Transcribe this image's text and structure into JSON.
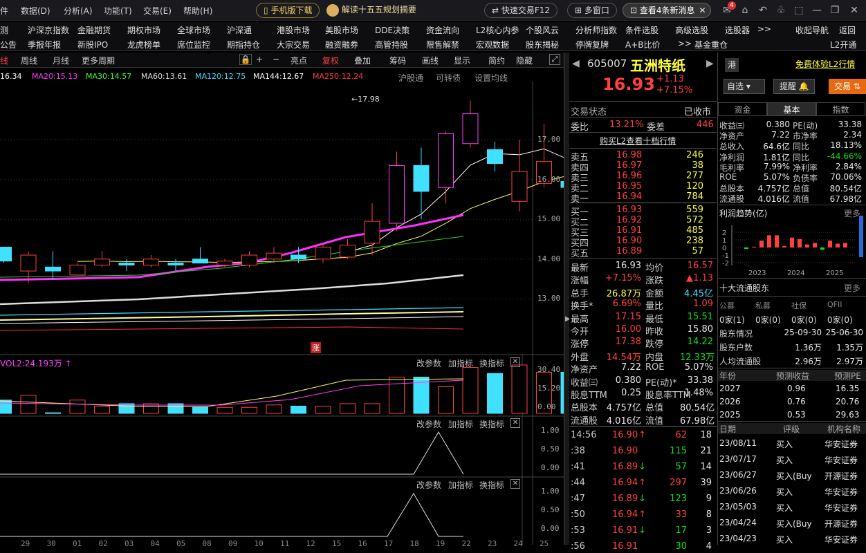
{
  "titlebar": {
    "menus": [
      "数据(D)",
      "分析(A)",
      "功能(T)",
      "交易(E)",
      "帮助(H)"
    ],
    "mobile_btn": "手机版下载",
    "promo": "解读十五五规划摘要",
    "quick_trade": "快速交易F12",
    "multi_window": "多窗口",
    "news": "查看4条新消息",
    "badge": "4"
  },
  "nav1": [
    "测",
    "沪深京指数",
    "金融期货",
    "期权市场",
    "全球市场",
    "沪深通",
    "港股市场",
    "美股市场",
    "DDE决策",
    "资金流向",
    "L2核心内参",
    "个股风云",
    "分析师指数",
    "条件选股",
    "高级选股",
    "选股器",
    ">>",
    "收起导航",
    "返回"
  ],
  "nav2": [
    "公告",
    "季报年报",
    "新股IPO",
    "龙虎榜单",
    "席位监控",
    "期指持仓",
    "大宗交易",
    "融资融券",
    "高管持股",
    "限售解禁",
    "宏观数据",
    "股东揭秘",
    "停牌复牌",
    "A+B比价",
    ">>",
    "基金重仓",
    "L2开通"
  ],
  "chartbar": {
    "tabs": [
      "线",
      "周线",
      "月线",
      "更多周期"
    ],
    "tools": [
      "亮点",
      "复权",
      "叠加",
      "筹码",
      "画线",
      "显示",
      "简约",
      "隐藏"
    ]
  },
  "ma_legend": [
    {
      "t": "16.34",
      "c": "#ffffff"
    },
    {
      "t": "MA20:15.13",
      "c": "#ff40ff"
    },
    {
      "t": "MA30:14.57",
      "c": "#40ff40"
    },
    {
      "t": "MA60:13.61",
      "c": "#e0e0e0"
    },
    {
      "t": "MA120:12.75",
      "c": "#40e0ff"
    },
    {
      "t": "MA144:12.67",
      "c": "#ffffff"
    },
    {
      "t": "MA250:12.24",
      "c": "#ff4040"
    }
  ],
  "ma_right": [
    "沪股通",
    "可转债",
    "设置均线"
  ],
  "chart_data": [
    {
      "type": "candlestick",
      "x": [
        "09",
        "10",
        "11",
        "12",
        "13",
        "14",
        "15",
        "16",
        "17",
        "18",
        "19",
        "20",
        "21",
        "22",
        "23",
        "24",
        "25",
        "26",
        "27",
        "28",
        "29",
        "30",
        "01",
        "02",
        "03",
        "04",
        "05"
      ],
      "candles": [
        {
          "o": 14.0,
          "h": 14.2,
          "l": 13.8,
          "c": 14.1
        },
        {
          "o": 14.3,
          "h": 14.3,
          "l": 13.9,
          "c": 13.95
        },
        {
          "o": 13.7,
          "h": 14.2,
          "l": 13.4,
          "c": 14.1
        },
        {
          "o": 13.8,
          "h": 14.2,
          "l": 13.5,
          "c": 13.7
        },
        {
          "o": 13.6,
          "h": 13.9,
          "l": 13.6,
          "c": 13.85
        },
        {
          "o": 13.85,
          "h": 14.2,
          "l": 13.8,
          "c": 14.0
        },
        {
          "o": 13.9,
          "h": 14.0,
          "l": 13.7,
          "c": 13.85
        },
        {
          "o": 13.85,
          "h": 14.1,
          "l": 13.8,
          "c": 14.0
        },
        {
          "o": 13.9,
          "h": 14.0,
          "l": 13.7,
          "c": 13.85
        },
        {
          "o": 14.0,
          "h": 14.3,
          "l": 13.9,
          "c": 13.9
        },
        {
          "o": 13.85,
          "h": 14.0,
          "l": 13.8,
          "c": 13.95
        },
        {
          "o": 13.85,
          "h": 14.2,
          "l": 13.8,
          "c": 14.1
        },
        {
          "o": 14.0,
          "h": 14.3,
          "l": 13.9,
          "c": 14.15
        },
        {
          "o": 14.1,
          "h": 14.3,
          "l": 13.9,
          "c": 14.0
        },
        {
          "o": 14.0,
          "h": 14.4,
          "l": 13.9,
          "c": 14.3
        },
        {
          "o": 14.05,
          "h": 14.5,
          "l": 14.0,
          "c": 14.35
        },
        {
          "o": 14.4,
          "h": 15.4,
          "l": 14.1,
          "c": 14.95
        },
        {
          "o": 14.9,
          "h": 16.7,
          "l": 14.7,
          "c": 16.35
        },
        {
          "o": 16.35,
          "h": 16.8,
          "l": 15.0,
          "c": 15.7
        },
        {
          "o": 15.8,
          "h": 17.2,
          "l": 15.4,
          "c": 17.15
        },
        {
          "o": 16.9,
          "h": 17.98,
          "l": 16.8,
          "c": 17.65
        },
        {
          "o": 16.75,
          "h": 16.95,
          "l": 16.2,
          "c": 16.4
        },
        {
          "o": 15.45,
          "h": 17.0,
          "l": 15.2,
          "c": 16.2
        },
        {
          "o": 15.9,
          "h": 17.4,
          "l": 15.8,
          "c": 16.45
        },
        {
          "o": 15.95,
          "h": 16.1,
          "l": 15.7,
          "c": 15.8
        },
        {
          "o": 15.8,
          "h": 16.1,
          "l": 15.6,
          "c": 15.95
        },
        {
          "o": 16.0,
          "h": 17.15,
          "l": 15.51,
          "c": 16.93
        }
      ],
      "high_label": "17.98",
      "ylabels": [
        "17.00",
        "16.00",
        "15.00",
        "14.00",
        "13.00"
      ],
      "limit_up_tag": "涨"
    },
    {
      "type": "bar",
      "title": "VOL2:24.193万",
      "values": [
        0.5,
        11,
        15,
        0.5,
        11,
        6,
        8,
        8,
        8,
        5,
        5,
        5,
        7,
        6,
        6,
        8,
        8,
        30,
        30,
        22,
        38,
        33,
        40,
        34,
        34,
        37,
        37
      ],
      "ylabels": [
        "30.40",
        "15.20",
        "0.00"
      ]
    }
  ],
  "subpanels": {
    "links": [
      "改参数",
      "加指标",
      "换指标"
    ],
    "axis1": [
      "1.00",
      "0.50",
      "0.00"
    ],
    "axis2": [
      "1.00",
      "0.50",
      "0.00"
    ]
  },
  "bottom_dates": [
    "29",
    "30",
    "01",
    "02",
    "03",
    "04",
    "05",
    "08",
    "09",
    "10",
    "11",
    "12",
    "15",
    "16",
    "17",
    "18",
    "19",
    "22",
    "23",
    "24",
    "25"
  ],
  "quote": {
    "code": "605007",
    "name": "五洲特纸",
    "price": "16.93",
    "change": "+1.13",
    "pct": "+7.15%",
    "status_label": "交易状态",
    "status": "已收市",
    "weibi_label": "委比",
    "weibi": "13.21%",
    "weicha_label": "委差",
    "weicha": "446",
    "l2_link": "购买L2查看十档行情",
    "asks": [
      [
        "卖五",
        "16.98",
        "246"
      ],
      [
        "卖四",
        "16.97",
        "38"
      ],
      [
        "卖三",
        "16.96",
        "277"
      ],
      [
        "卖二",
        "16.95",
        "120"
      ],
      [
        "卖一",
        "16.94",
        "784"
      ]
    ],
    "bids": [
      [
        "买一",
        "16.93",
        "559"
      ],
      [
        "买二",
        "16.92",
        "572"
      ],
      [
        "买三",
        "16.91",
        "485"
      ],
      [
        "买四",
        "16.90",
        "238"
      ],
      [
        "买五",
        "16.89",
        "57"
      ]
    ],
    "stats": [
      [
        "最新",
        "16.93",
        "均价",
        "16.57"
      ],
      [
        "涨幅",
        "+7.15%",
        "涨跌",
        "▲1.13"
      ],
      [
        "总手",
        "26.87万",
        "金额",
        "4.45亿"
      ],
      [
        "换手*",
        "6.69%",
        "量比",
        "1.09"
      ],
      [
        "最高",
        "17.15",
        "最低",
        "15.51"
      ],
      [
        "今开",
        "16.00",
        "昨收",
        "15.80"
      ],
      [
        "涨停",
        "17.38",
        "跌停",
        "14.22"
      ],
      [
        "外盘",
        "14.54万",
        "内盘",
        "12.33万"
      ],
      [
        "净资产",
        "7.22",
        "ROE",
        "5.07%"
      ],
      [
        "收益㈢",
        "0.380",
        "PE(动)*",
        "33.38"
      ],
      [
        "股息TTM",
        "0.25",
        "股息率TTM",
        "1.48%"
      ],
      [
        "总股本",
        "4.757亿",
        "总值",
        "80.54亿"
      ],
      [
        "流通股",
        "4.016亿",
        "流值",
        "67.98亿"
      ]
    ],
    "ticks": [
      [
        "14:56",
        "16.90",
        "↑",
        "62",
        "18"
      ],
      [
        ":38",
        "16.90",
        "",
        "115",
        "21"
      ],
      [
        ":41",
        "16.89",
        "↓",
        "57",
        "14"
      ],
      [
        ":44",
        "16.94",
        "↑",
        "297",
        "39"
      ],
      [
        ":47",
        "16.89",
        "↓",
        "123",
        "9"
      ],
      [
        ":50",
        "16.94",
        "↑",
        "33",
        "8"
      ],
      [
        ":53",
        "16.91",
        "↓",
        "17",
        "3"
      ],
      [
        ":56",
        "16.91",
        "",
        "30",
        "4"
      ]
    ]
  },
  "f10": {
    "hk": "港",
    "free_l2": "免费体验L2行情",
    "zixuan": "自选",
    "tixing": "提醒",
    "trade": "交易",
    "tabs": [
      "资金",
      "基本",
      "指数"
    ],
    "fund": [
      [
        "收益㈢",
        "0.380",
        "PE(动)",
        "33.38"
      ],
      [
        "净资产",
        "7.22",
        "市净率",
        "2.34"
      ],
      [
        "总收入",
        "64.6亿",
        "同比",
        "18.13%"
      ],
      [
        "净利润",
        "1.81亿",
        "同比",
        "-44.66%"
      ],
      [
        "毛利率",
        "7.99%",
        "净利率",
        "2.84%"
      ],
      [
        "ROE",
        "5.07%",
        "负债率",
        "70.06%"
      ],
      [
        "总股本",
        "4.757亿",
        "总值",
        "80.54亿"
      ],
      [
        "流通股",
        "4.016亿",
        "流值",
        "67.98亿"
      ]
    ],
    "profit_title": "利润趋势(亿)",
    "more": "更多",
    "profit_years": [
      "2023",
      "2024",
      "2025"
    ],
    "profit_axis": [
      "2",
      "1",
      "0",
      "-1",
      "-2"
    ],
    "profit_values": [
      -0.2,
      0.1,
      0.9,
      1.6,
      1.6,
      0.2,
      1.3,
      1.1,
      0.4,
      0.6,
      -0.3,
      0.9,
      0.5,
      0.6
    ],
    "holders_title": "十大流通股东",
    "holder_cols": [
      "公募",
      "私募",
      "社保",
      "QFII"
    ],
    "holder_vals": [
      "0家(1)",
      "0家(0)",
      "0家(0)",
      "0家(0)"
    ],
    "holder_rows": [
      [
        "股东情况",
        "25-09-30",
        "25-06-30"
      ],
      [
        "股东户数",
        "1.36万",
        "1.35万"
      ],
      [
        "人均流通股",
        "2.96万",
        "2.97万"
      ]
    ],
    "forecast_head": [
      "年份",
      "预测收益",
      "预测PE"
    ],
    "forecast": [
      [
        "2027",
        "0.96",
        "16.35"
      ],
      [
        "2026",
        "0.76",
        "20.76"
      ],
      [
        "2025",
        "0.53",
        "29.63"
      ]
    ],
    "rating_head": [
      "日期",
      "评级",
      "机构名称"
    ],
    "ratings": [
      [
        "23/08/11",
        "买入",
        "华安证券"
      ],
      [
        "23/07/17",
        "买入",
        "华安证券"
      ],
      [
        "23/06/27",
        "买入(Buy",
        "开源证券"
      ],
      [
        "23/06/26",
        "买入",
        "华安证券"
      ],
      [
        "23/05/03",
        "买入",
        "华安证券"
      ],
      [
        "23/04/24",
        "买入(Buy",
        "开源证券"
      ],
      [
        "23/04/23",
        "买入",
        "华安证券"
      ]
    ]
  }
}
